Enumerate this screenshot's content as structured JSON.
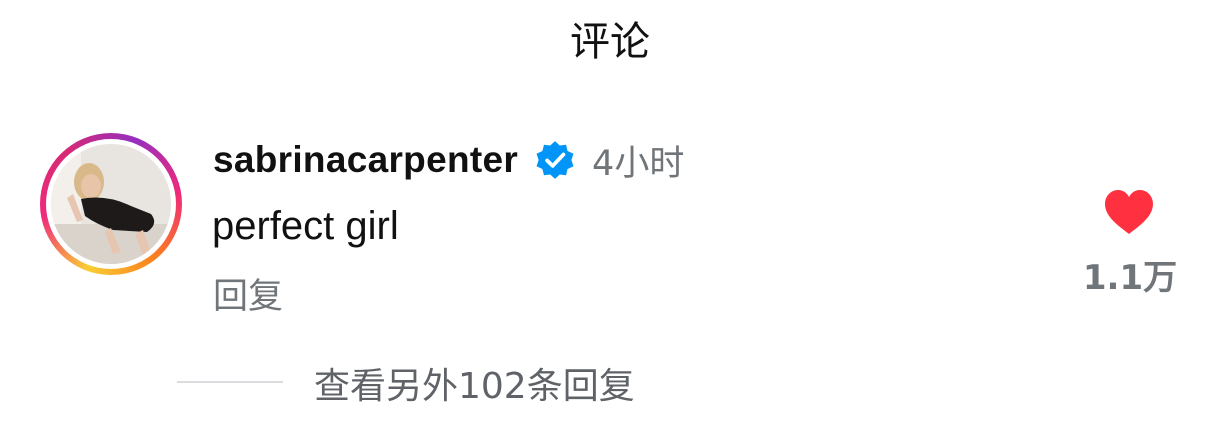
{
  "header": {
    "title": "评论"
  },
  "comment": {
    "avatar_icon": "user-avatar-photo",
    "username": "sabrinacarpenter",
    "verified_icon": "verified-badge-icon",
    "time": "4小时",
    "text": "perfect girl",
    "reply_label": "回复",
    "like_icon": "heart-filled-icon",
    "like_count": "1.1万",
    "view_replies_label": "查看另外102条回复"
  },
  "colors": {
    "like": "#ff3040",
    "verified": "#0095f6",
    "secondary_text": "#70757a"
  }
}
